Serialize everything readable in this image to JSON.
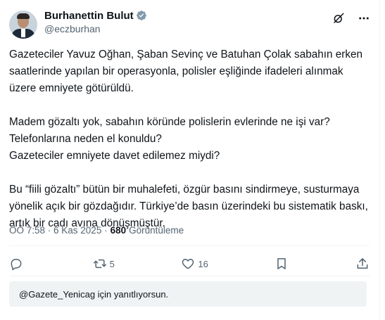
{
  "author": {
    "display_name": "Burhanettin Bulut",
    "handle": "@eczburhan"
  },
  "tweet": {
    "paragraphs": [
      "Gazeteciler Yavuz Oğhan, Şaban Sevinç ve Batuhan Çolak sabahın erken saatlerinde yapılan bir operasyonla, polisler eşliğinde ifadeleri alınmak üzere emniyete götürüldü.",
      "Madem gözaltı yok, sabahın köründe polislerin evlerinde ne işi var?\nTelefonlarına neden el konuldu?\nGazeteciler emniyete davet edilemez miydi?",
      "Bu “fiili gözaltı” bütün bir muhalefeti, özgür basını sindirmeye, susturmaya yönelik açık bir gözdağıdır. Türkiye’de basın üzerindeki bu sistematik baskı, artık bir cadı avına dönüşmüştür."
    ]
  },
  "meta": {
    "time_date": "ÖÖ 7:58 · 6 Kas 2025 ·",
    "views_count": "680",
    "views_label": "Görüntüleme"
  },
  "actions": {
    "reply_count": "",
    "retweet_count": "5",
    "like_count": "16"
  },
  "reply_box": {
    "text": "@Gazete_Yenicag için yanıtlıyorsun."
  },
  "icons": {
    "verified": "verified-badge-icon",
    "grok": "grok-icon",
    "more": "more-options-icon",
    "reply": "reply-icon",
    "retweet": "retweet-icon",
    "like": "heart-icon",
    "bookmark": "bookmark-icon",
    "share": "share-icon"
  },
  "colors": {
    "verified": "#829aab",
    "secondary_text": "#536471",
    "primary_text": "#0f1419",
    "reply_box_bg": "#eff3f4"
  }
}
